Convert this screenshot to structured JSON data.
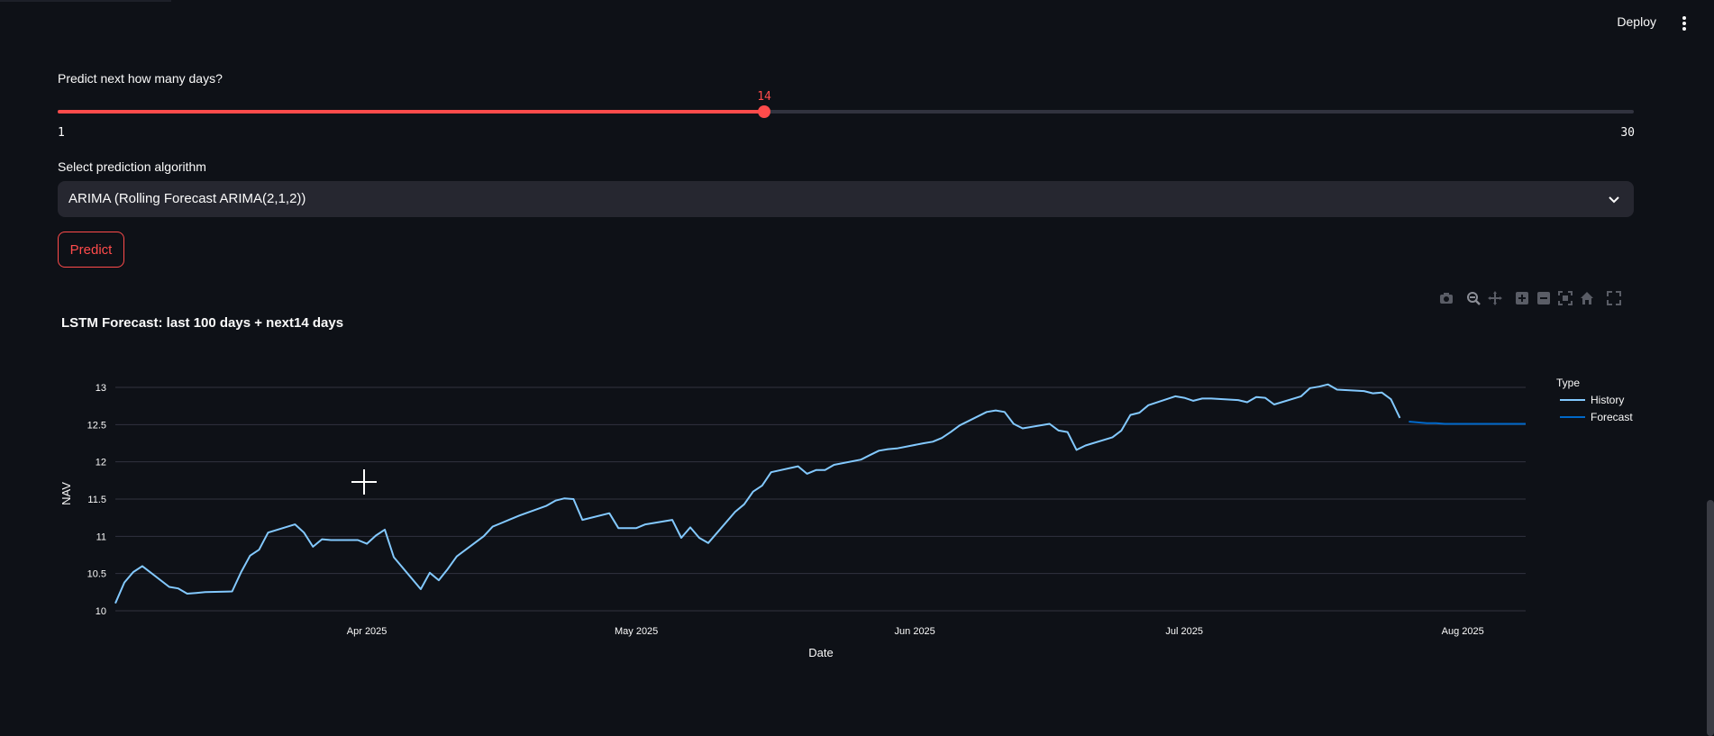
{
  "header": {
    "deploy_label": "Deploy",
    "menu_icon": "more-vertical-icon"
  },
  "slider": {
    "label": "Predict next how many days?",
    "value": 14,
    "value_label": "14",
    "min": 1,
    "max": 30,
    "min_label": "1",
    "max_label": "30",
    "accent": "#ff4b4b"
  },
  "select": {
    "label": "Select prediction algorithm",
    "value": "ARIMA (Rolling Forecast ARIMA(2,1,2))"
  },
  "predict_button": {
    "label": "Predict"
  },
  "modebar": {
    "icons": [
      "camera-icon",
      "zoom-icon",
      "pan-icon",
      "zoom-in-icon",
      "zoom-out-icon",
      "autoscale-icon",
      "home-icon",
      "fullscreen-icon"
    ]
  },
  "chart_data": {
    "type": "line",
    "title": "LSTM Forecast: last 100 days + next14 days",
    "xlabel": "Date",
    "ylabel": "NAV",
    "ylim": [
      10,
      13
    ],
    "yticks": [
      10,
      10.5,
      11,
      11.5,
      12,
      12.5,
      13
    ],
    "ytick_labels": [
      "10",
      "10.5",
      "11",
      "11.5",
      "12",
      "12.5",
      "13"
    ],
    "xtick_labels": [
      "Apr 2025",
      "May 2025",
      "Jun 2025",
      "Jul 2025",
      "Aug 2025"
    ],
    "xtick_dates": [
      "2025-04-01",
      "2025-05-01",
      "2025-06-01",
      "2025-07-01",
      "2025-08-01"
    ],
    "xlim": [
      "2025-03-04",
      "2025-08-08"
    ],
    "grid": true,
    "legend": {
      "title": "Type",
      "placement": "right"
    },
    "series": [
      {
        "name": "History",
        "color": "#83c9ff",
        "x": [
          "2025-03-04",
          "2025-03-05",
          "2025-03-06",
          "2025-03-07",
          "2025-03-10",
          "2025-03-11",
          "2025-03-12",
          "2025-03-13",
          "2025-03-14",
          "2025-03-17",
          "2025-03-18",
          "2025-03-19",
          "2025-03-20",
          "2025-03-21",
          "2025-03-24",
          "2025-03-25",
          "2025-03-26",
          "2025-03-27",
          "2025-03-28",
          "2025-03-31",
          "2025-04-01",
          "2025-04-02",
          "2025-04-03",
          "2025-04-04",
          "2025-04-07",
          "2025-04-08",
          "2025-04-09",
          "2025-04-10",
          "2025-04-11",
          "2025-04-14",
          "2025-04-15",
          "2025-04-16",
          "2025-04-17",
          "2025-04-18",
          "2025-04-21",
          "2025-04-22",
          "2025-04-23",
          "2025-04-24",
          "2025-04-25",
          "2025-04-28",
          "2025-04-29",
          "2025-04-30",
          "2025-05-01",
          "2025-05-02",
          "2025-05-05",
          "2025-05-06",
          "2025-05-07",
          "2025-05-08",
          "2025-05-09",
          "2025-05-12",
          "2025-05-13",
          "2025-05-14",
          "2025-05-15",
          "2025-05-16",
          "2025-05-19",
          "2025-05-20",
          "2025-05-21",
          "2025-05-22",
          "2025-05-23",
          "2025-05-26",
          "2025-05-27",
          "2025-05-28",
          "2025-05-29",
          "2025-05-30",
          "2025-06-02",
          "2025-06-03",
          "2025-06-04",
          "2025-06-05",
          "2025-06-06",
          "2025-06-09",
          "2025-06-10",
          "2025-06-11",
          "2025-06-12",
          "2025-06-13",
          "2025-06-16",
          "2025-06-17",
          "2025-06-18",
          "2025-06-19",
          "2025-06-20",
          "2025-06-23",
          "2025-06-24",
          "2025-06-25",
          "2025-06-26",
          "2025-06-27",
          "2025-06-30",
          "2025-07-01",
          "2025-07-02",
          "2025-07-03",
          "2025-07-04",
          "2025-07-07",
          "2025-07-08",
          "2025-07-09",
          "2025-07-10",
          "2025-07-11",
          "2025-07-14",
          "2025-07-15",
          "2025-07-16",
          "2025-07-17",
          "2025-07-18",
          "2025-07-21",
          "2025-07-22",
          "2025-07-23",
          "2025-07-24",
          "2025-07-25"
        ],
        "y": [
          10.1,
          10.38,
          10.52,
          10.6,
          10.32,
          10.3,
          10.23,
          10.24,
          10.25,
          10.26,
          10.52,
          10.74,
          10.82,
          11.05,
          11.16,
          11.05,
          10.86,
          10.96,
          10.95,
          10.95,
          10.9,
          11.01,
          11.09,
          10.72,
          10.29,
          10.51,
          10.41,
          10.56,
          10.73,
          11.0,
          11.13,
          11.18,
          11.23,
          11.28,
          11.41,
          11.48,
          11.51,
          11.5,
          11.22,
          11.31,
          11.11,
          11.11,
          11.11,
          11.16,
          11.22,
          10.98,
          11.12,
          10.98,
          10.91,
          11.33,
          11.43,
          11.6,
          11.68,
          11.86,
          11.94,
          11.84,
          11.89,
          11.89,
          11.96,
          12.03,
          12.09,
          12.15,
          12.17,
          12.18,
          12.25,
          12.27,
          12.32,
          12.4,
          12.49,
          12.67,
          12.69,
          12.67,
          12.51,
          12.45,
          12.51,
          12.42,
          12.4,
          12.16,
          12.22,
          12.33,
          12.42,
          12.63,
          12.66,
          12.76,
          12.88,
          12.86,
          12.82,
          12.85,
          12.85,
          12.83,
          12.8,
          12.87,
          12.86,
          12.77,
          12.88,
          12.99,
          13.01,
          13.04,
          12.97,
          12.95,
          12.92,
          12.93,
          12.84,
          12.59
        ]
      },
      {
        "name": "Forecast",
        "color": "#0068c9",
        "x": [
          "2025-07-26",
          "2025-07-27",
          "2025-07-28",
          "2025-07-29",
          "2025-07-30",
          "2025-07-31",
          "2025-08-01",
          "2025-08-02",
          "2025-08-03",
          "2025-08-04",
          "2025-08-05",
          "2025-08-06",
          "2025-08-07",
          "2025-08-08"
        ],
        "y": [
          12.54,
          12.53,
          12.52,
          12.52,
          12.51,
          12.51,
          12.51,
          12.51,
          12.51,
          12.51,
          12.51,
          12.51,
          12.51,
          12.51
        ]
      }
    ]
  }
}
